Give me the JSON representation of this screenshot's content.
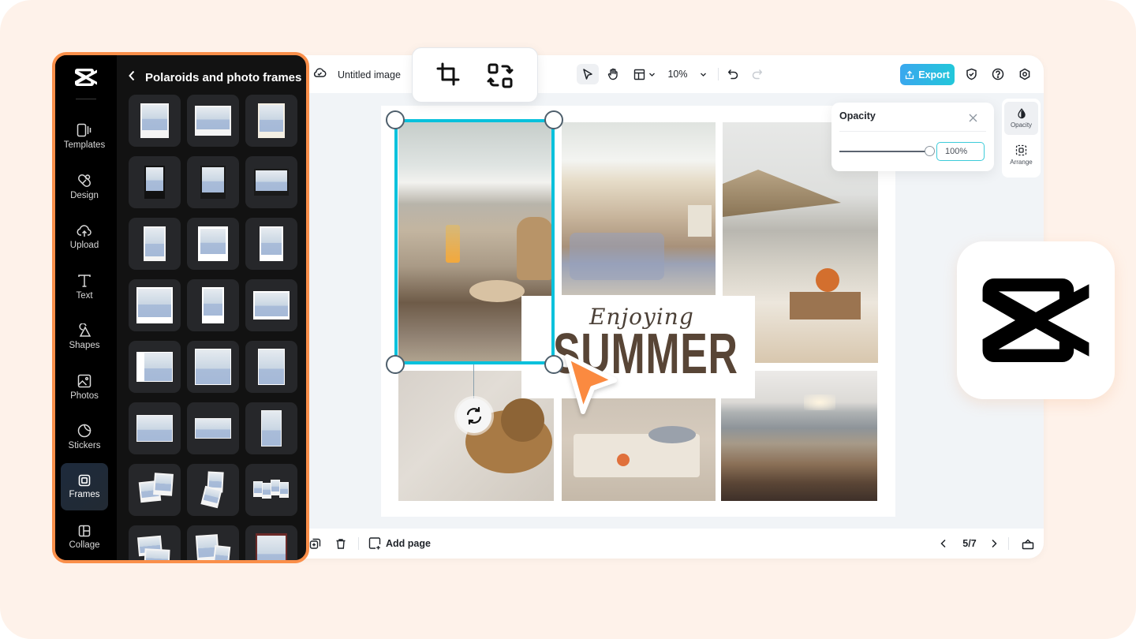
{
  "app": {
    "name": "CapCut",
    "document_title": "Untitled image",
    "accent_color": "#08c1dc",
    "highlight_color": "#fa8f4a"
  },
  "left_rail": {
    "items": [
      {
        "label": "Templates",
        "icon": "templates-icon"
      },
      {
        "label": "Design",
        "icon": "design-icon"
      },
      {
        "label": "Upload",
        "icon": "upload-cloud-icon"
      },
      {
        "label": "Text",
        "icon": "text-icon"
      },
      {
        "label": "Shapes",
        "icon": "shapes-icon"
      },
      {
        "label": "Photos",
        "icon": "photos-icon"
      },
      {
        "label": "Stickers",
        "icon": "stickers-icon"
      },
      {
        "label": "Frames",
        "icon": "frames-icon",
        "active": true
      },
      {
        "label": "Collage",
        "icon": "collage-icon"
      }
    ]
  },
  "panel": {
    "title": "Polaroids and photo frames",
    "back_icon": "chevron-left-icon",
    "frames_count_visible": 21
  },
  "toolbar": {
    "select_tool": "pointer-icon",
    "hand_tool": "hand-icon",
    "layout_tool": "layout-icon",
    "zoom_value": "10%",
    "undo": "undo-icon",
    "redo": "redo-icon",
    "export_label": "Export"
  },
  "crop_toolbar": {
    "crop": "crop-icon",
    "replace": "replace-icon"
  },
  "opacity_panel": {
    "title": "Opacity",
    "value": "100%",
    "slider_fraction": 1.0
  },
  "side_props": {
    "items": [
      {
        "label": "Opacity",
        "active": true
      },
      {
        "label": "Arrange"
      }
    ]
  },
  "canvas": {
    "script_text": "Enjoying",
    "headline": "SUMMER"
  },
  "bottombar": {
    "add_page_label": "Add page",
    "page_indicator": "5/7"
  }
}
